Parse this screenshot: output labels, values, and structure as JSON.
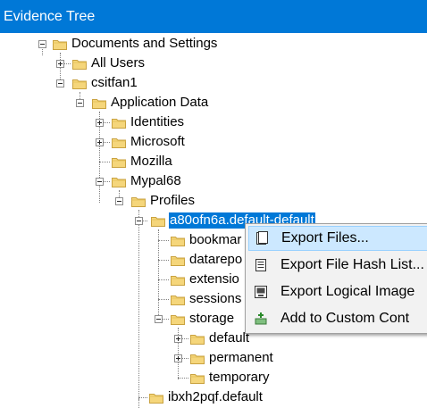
{
  "panel": {
    "title": "Evidence Tree"
  },
  "tree": {
    "nodes": [
      {
        "label": "Documents and Settings",
        "expander": "minus"
      },
      {
        "label": "All Users",
        "expander": "plus"
      },
      {
        "label": "csitfan1",
        "expander": "minus"
      },
      {
        "label": "Application Data",
        "expander": "minus"
      },
      {
        "label": "Identities",
        "expander": "plus"
      },
      {
        "label": "Microsoft",
        "expander": "plus"
      },
      {
        "label": "Mozilla",
        "expander": "none"
      },
      {
        "label": "Mypal68",
        "expander": "minus"
      },
      {
        "label": "Profiles",
        "expander": "minus"
      },
      {
        "label": "a80ofn6a.default-default",
        "expander": "minus",
        "selected": true
      },
      {
        "label": "bookmar",
        "expander": "none"
      },
      {
        "label": "datarepo",
        "expander": "none"
      },
      {
        "label": "extensio",
        "expander": "none"
      },
      {
        "label": "sessions",
        "expander": "none"
      },
      {
        "label": "storage",
        "expander": "minus"
      },
      {
        "label": "default",
        "expander": "plus"
      },
      {
        "label": "permanent",
        "expander": "plus"
      },
      {
        "label": "temporary",
        "expander": "none"
      },
      {
        "label": "ibxh2pqf.default",
        "expander": "none"
      }
    ]
  },
  "context_menu": {
    "items": [
      {
        "label": "Export Files...",
        "icon": "export-files-icon",
        "highlighted": true
      },
      {
        "label": "Export File Hash List...",
        "icon": "hash-list-icon"
      },
      {
        "label": "Export Logical Image",
        "icon": "logical-image-icon"
      },
      {
        "label": "Add to Custom Cont",
        "icon": "add-custom-content-icon"
      }
    ]
  },
  "colors": {
    "title_bar": "#0078d7",
    "selection": "#0078d7",
    "menu_background": "#f2f2f2",
    "menu_hover": "#cce8ff",
    "folder_fill": "#f5d67b",
    "folder_edge": "#c9a240"
  }
}
